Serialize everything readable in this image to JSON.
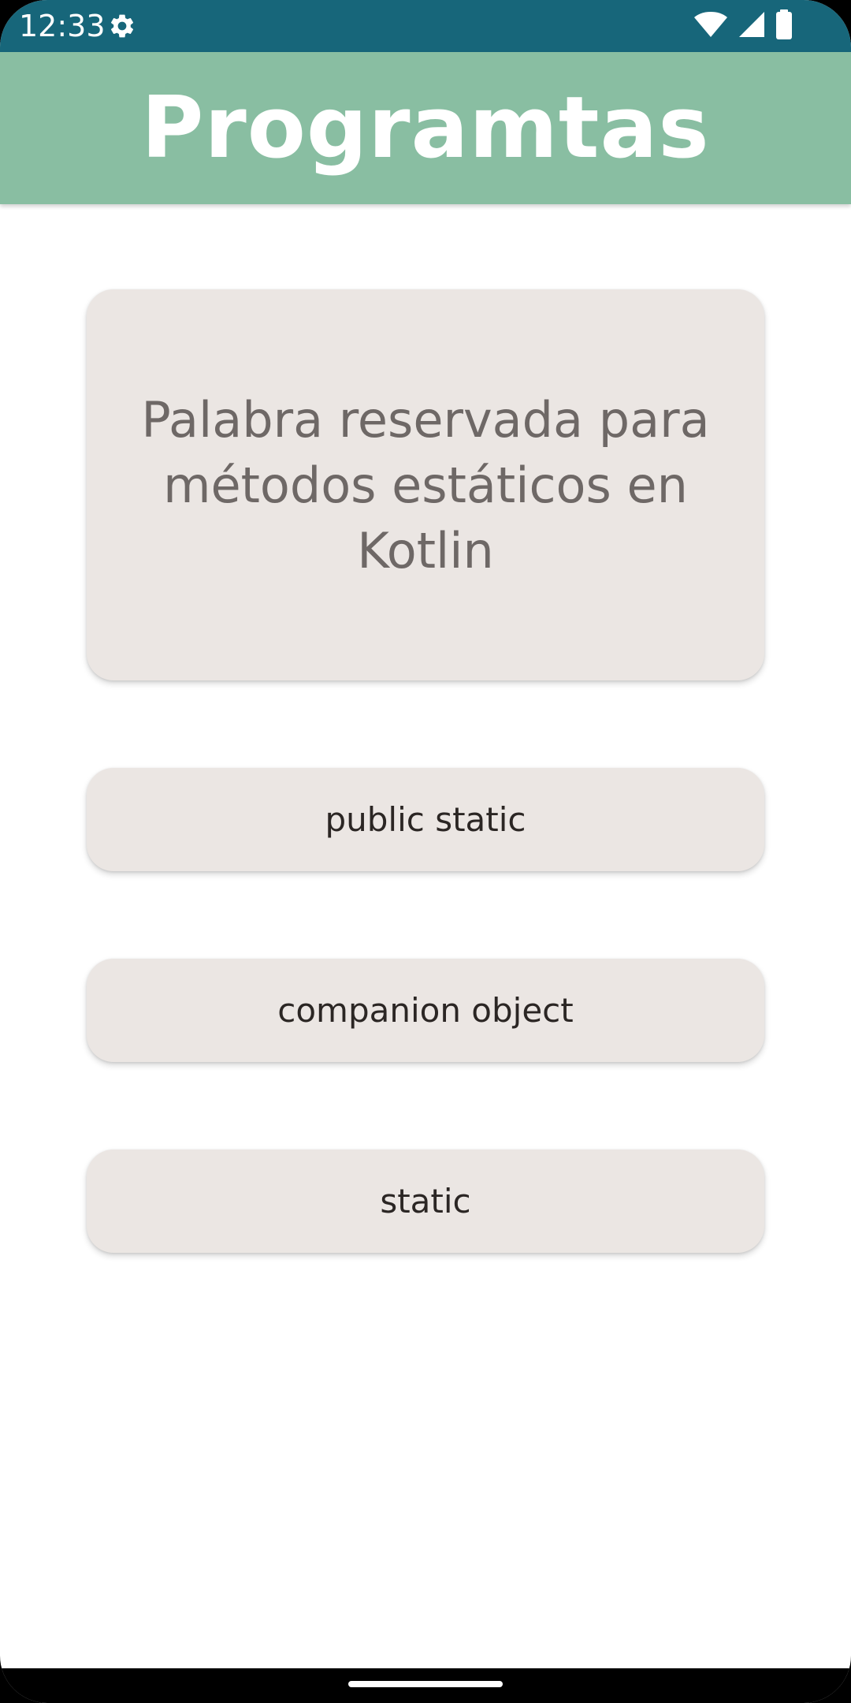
{
  "status_bar": {
    "time": "12:33",
    "icons": [
      "gear-icon",
      "wifi-icon",
      "signal-icon",
      "battery-icon"
    ],
    "background": "#17667a"
  },
  "app_bar": {
    "title": "Programtas",
    "background": "#89bea2"
  },
  "question": {
    "text": "Palabra reservada para métodos estáticos en Kotlin"
  },
  "options": [
    {
      "label": "public static"
    },
    {
      "label": "companion object"
    },
    {
      "label": "static"
    }
  ],
  "colors": {
    "card_background": "#ebe6e3",
    "question_text": "#6e6866",
    "option_text": "#2b2624"
  }
}
